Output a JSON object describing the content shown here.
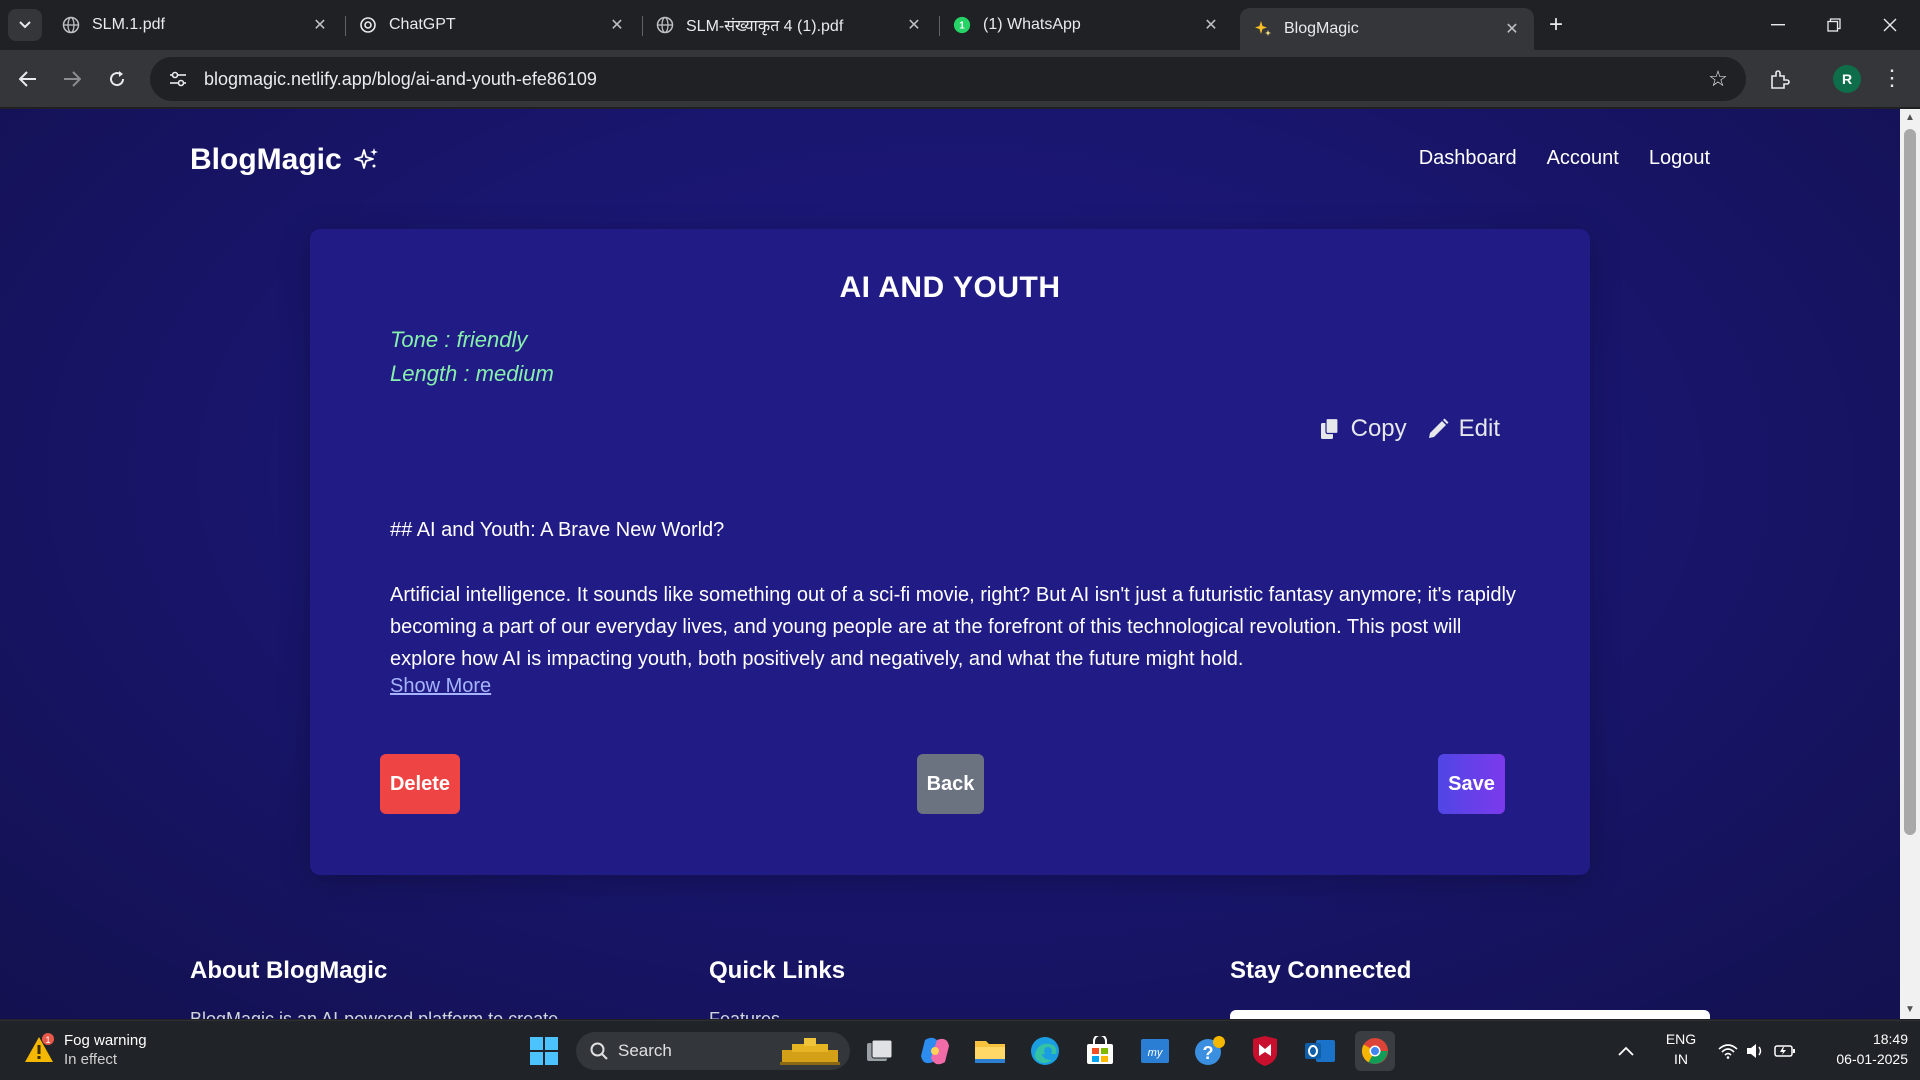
{
  "browser": {
    "tabs": [
      {
        "title": "SLM.1.pdf",
        "favicon": "globe-icon",
        "active": false
      },
      {
        "title": "ChatGPT",
        "favicon": "chatgpt-icon",
        "active": false
      },
      {
        "title": "SLM-संख्याकृत 4 (1).pdf",
        "favicon": "globe-icon",
        "active": false
      },
      {
        "title": "(1) WhatsApp",
        "favicon": "whatsapp-icon",
        "active": false
      },
      {
        "title": "BlogMagic",
        "favicon": "sparkle-icon",
        "active": true
      }
    ],
    "url": "blogmagic.netlify.app/blog/ai-and-youth-efe86109",
    "profile_initial": "R"
  },
  "site": {
    "logo": "BlogMagic",
    "nav": [
      "Dashboard",
      "Account",
      "Logout"
    ]
  },
  "post": {
    "title": "AI AND YOUTH",
    "tone": "Tone : friendly",
    "length": "Length : medium",
    "copy_label": "Copy",
    "edit_label": "Edit",
    "heading": "## AI and Youth: A Brave New World?",
    "body": "Artificial intelligence. It sounds like something out of a sci-fi movie, right?  But AI isn't just a futuristic fantasy anymore; it's rapidly becoming a part of our everyday lives, and young people are at the forefront of this technological revolution.  This post will explore how AI is impacting youth, both positively and negatively, and what the future might hold.",
    "show_more": "Show More",
    "delete_label": "Delete",
    "back_label": "Back",
    "save_label": "Save"
  },
  "footer": {
    "about_title": "About BlogMagic",
    "about_text": "BlogMagic is an AI-powered platform to create",
    "links_title": "Quick Links",
    "links_first": "Features",
    "connect_title": "Stay Connected"
  },
  "taskbar": {
    "weather_title": "Fog warning",
    "weather_sub": "In effect",
    "weather_badge": "1",
    "search_label": "Search",
    "lang_top": "ENG",
    "lang_bottom": "IN",
    "time": "18:49",
    "date": "06-01-2025"
  },
  "colors": {
    "accent_green": "#86efac",
    "delete": "#ef4444",
    "back": "#6b7280",
    "save_from": "#4f46e5",
    "save_to": "#7c3aed",
    "page_bg": "#191670"
  }
}
